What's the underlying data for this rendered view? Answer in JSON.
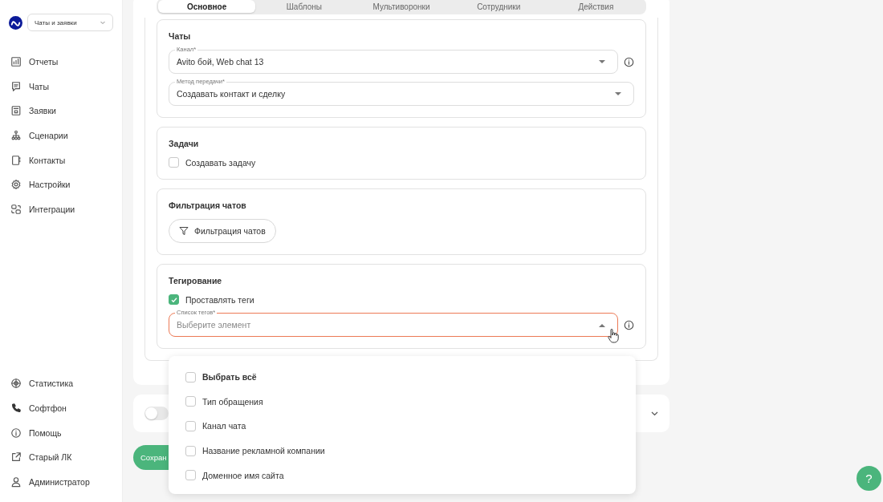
{
  "sidebar": {
    "product_select": {
      "value": "Чаты и заявки"
    },
    "items": [
      {
        "label": "Отчеты"
      },
      {
        "label": "Чаты"
      },
      {
        "label": "Заявки"
      },
      {
        "label": "Сценарии"
      },
      {
        "label": "Контакты"
      },
      {
        "label": "Настройки"
      },
      {
        "label": "Интеграции"
      }
    ],
    "bottom_items": [
      {
        "label": "Статистика"
      },
      {
        "label": "Софтфон"
      },
      {
        "label": "Помощь"
      },
      {
        "label": "Старый ЛК"
      },
      {
        "label": "Администратор"
      }
    ]
  },
  "tabs": [
    {
      "label": "Основное",
      "selected": true
    },
    {
      "label": "Шаблоны",
      "selected": false
    },
    {
      "label": "Мультиворонки",
      "selected": false
    },
    {
      "label": "Сотрудники",
      "selected": false
    },
    {
      "label": "Действия",
      "selected": false
    }
  ],
  "sections": [
    {
      "title": "Чаты",
      "rows": [
        {
          "kind": "select",
          "label": "Канал*",
          "value": "Avito бой, Web chat 13",
          "info": true
        },
        {
          "kind": "select",
          "label": "Метод передачи*",
          "value": "Создавать контакт и сделку",
          "info": false
        }
      ]
    },
    {
      "title": "Задачи",
      "rows": [
        {
          "kind": "checkbox",
          "label": "Создавать задачу",
          "checked": false
        }
      ]
    },
    {
      "title": "Фильтрация чатов",
      "rows": [
        {
          "kind": "button",
          "label": "Фильтрация чатов"
        }
      ]
    },
    {
      "title": "Тегирование",
      "rows": [
        {
          "kind": "checkbox",
          "label": "Проставлять теги",
          "checked": true
        },
        {
          "kind": "select",
          "label": "Список тегов*",
          "placeholder": "Выберите элемент",
          "info": true,
          "error": true,
          "expanded": true
        }
      ]
    }
  ],
  "dropdown": {
    "options": [
      {
        "label": "Выбрать всё",
        "checked": false,
        "bold": true
      },
      {
        "label": "Тип обращения",
        "checked": false,
        "bold": false
      },
      {
        "label": "Канал чата",
        "checked": false,
        "bold": false
      },
      {
        "label": "Название рекламной компании",
        "checked": false,
        "bold": false
      },
      {
        "label": "Доменное имя сайта",
        "checked": false,
        "bold": false
      }
    ]
  },
  "second_panel": {
    "toggle_on": false
  },
  "save_button": {
    "label": "Сохран"
  },
  "help_button": {
    "label": "?"
  }
}
